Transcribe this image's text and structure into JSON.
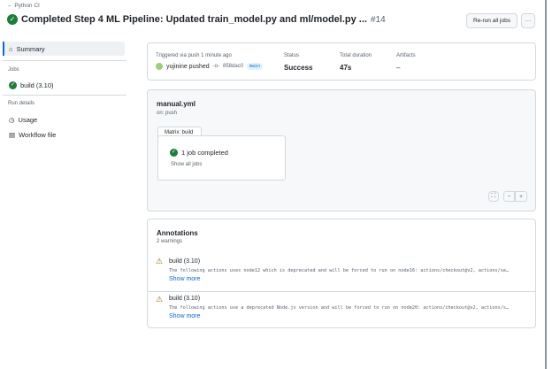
{
  "header": {
    "back_label": "Python CI",
    "title": "Completed Step 4 ML Pipeline: Updated train_model.py and ml/model.py ...",
    "run_number": "#14",
    "rerun_label": "Re-run all jobs",
    "more_label": "···"
  },
  "sidebar": {
    "summary": "Summary",
    "jobs_heading": "Jobs",
    "jobs": [
      {
        "label": "build (3.10)"
      }
    ],
    "run_details_heading": "Run details",
    "items": [
      {
        "label": "Usage"
      },
      {
        "label": "Workflow file"
      }
    ]
  },
  "summary": {
    "trigger_label": "Triggered via push 1 minute ago",
    "actor": "yujinine pushed",
    "commit": "858dac0",
    "branch": "main",
    "status_label": "Status",
    "status": "Success",
    "duration_label": "Total duration",
    "duration": "47s",
    "artifacts_label": "Artifacts",
    "artifacts": "–"
  },
  "workflow": {
    "file": "manual.yml",
    "trigger": "on: push",
    "matrix_tab": "Matrix: build",
    "job_status": "1 job completed",
    "show_all": "Show all jobs"
  },
  "annotations": {
    "title": "Annotations",
    "count": "2 warnings",
    "items": [
      {
        "job": "build (3.10)",
        "message": "The following actions uses node12 which is deprecated and will be forced to run on node16: actions/checkout@v2, actions/se…",
        "more": "Show more"
      },
      {
        "job": "build (3.10)",
        "message": "The following actions use a deprecated Node.js version and will be forced to run on node20: actions/checkout@v2, actions/s…",
        "more": "Show more"
      }
    ]
  }
}
